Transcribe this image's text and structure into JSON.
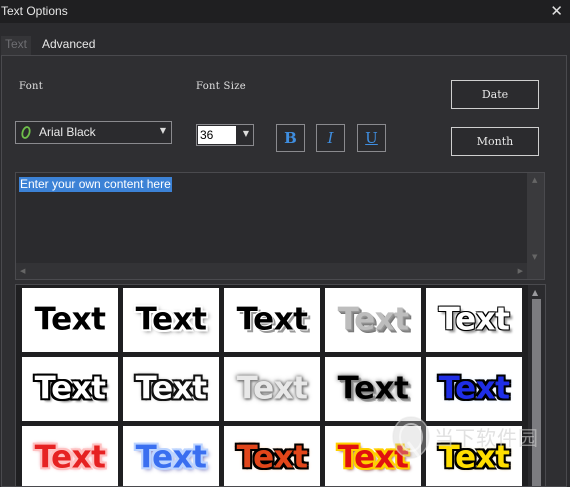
{
  "window": {
    "title": "Text Options",
    "close_glyph": "✕"
  },
  "tabs": [
    {
      "label": "Text",
      "active": false
    },
    {
      "label": "Advanced",
      "active": true
    }
  ],
  "font": {
    "label": "Font",
    "value": "Arial Black",
    "icon": "font-type-icon"
  },
  "font_size": {
    "label": "Font Size",
    "value": "36"
  },
  "format_buttons": {
    "bold": "B",
    "italic": "I",
    "underline": "U"
  },
  "side_buttons": {
    "date": "Date",
    "month": "Month"
  },
  "editor": {
    "content": "Enter your own content here"
  },
  "gallery": {
    "tiles": [
      "Text",
      "Text",
      "Text",
      "Text",
      "Text",
      "Text",
      "Text",
      "Text",
      "Text",
      "Text",
      "Text",
      "Text",
      "Text",
      "Text",
      "Text"
    ]
  },
  "watermark": {
    "text": "当下软件园"
  },
  "colors": {
    "accent_blue": "#3c82d6",
    "format_text": "#3f8ee0",
    "background": "#2b2b2e"
  }
}
